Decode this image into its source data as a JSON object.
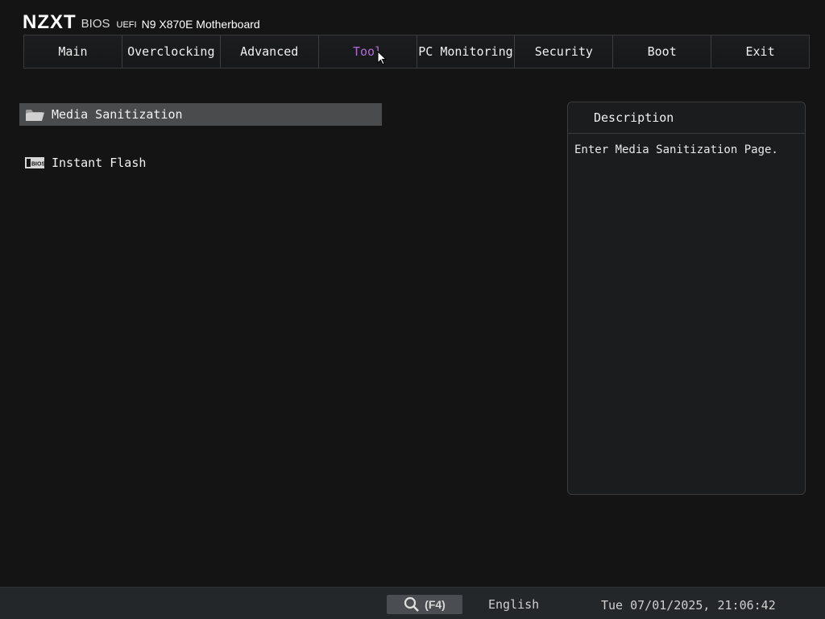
{
  "header": {
    "logo": "NZXT",
    "bios": "BIOS",
    "uefi": "UEFI",
    "model": "N9 X870E Motherboard"
  },
  "tabs": [
    {
      "label": "Main"
    },
    {
      "label": "Overclocking"
    },
    {
      "label": "Advanced"
    },
    {
      "label": "Tool",
      "active": true
    },
    {
      "label": "PC Monitoring"
    },
    {
      "label": "Security"
    },
    {
      "label": "Boot"
    },
    {
      "label": "Exit"
    }
  ],
  "menu": {
    "items": [
      {
        "label": "Media Sanitization",
        "icon": "folder-icon",
        "selected": true
      },
      {
        "label": "Instant Flash",
        "icon": "bios-chip-icon"
      }
    ]
  },
  "description": {
    "title": "Description",
    "text": "Enter Media Sanitization Page."
  },
  "footer": {
    "search_label": "(F4)",
    "language": "English",
    "datetime": "Tue 07/01/2025, 21:06:42"
  },
  "colors": {
    "active_tab": "#b06ad6",
    "selected_item": "#4a4b4c"
  }
}
